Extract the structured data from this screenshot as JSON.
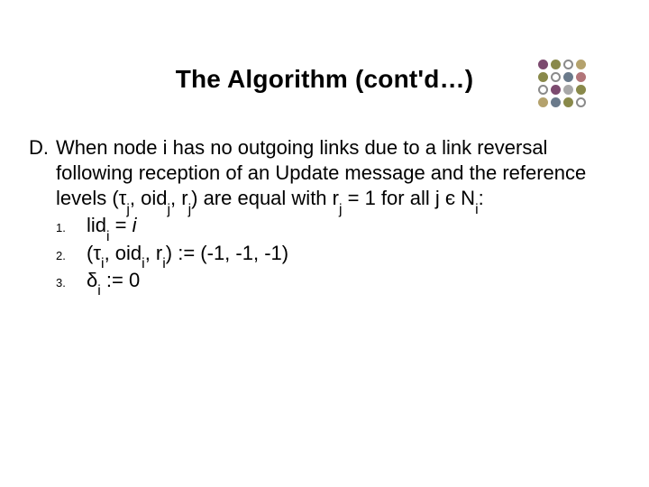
{
  "title": "The Algorithm (cont'd…)",
  "section": {
    "marker": "D.",
    "text_html": "When node i has no outgoing links due to a link reversal following reception of an Update message and the reference levels (τ<sub>j</sub>, oid<sub>j</sub>, r<sub>j</sub>) are equal with r<sub>j</sub> = 1 for all j є N<sub>i</sub>:"
  },
  "items": [
    {
      "num": "1.",
      "html": "lid<sub>i</sub> = <span class=\"ital\">i</span>"
    },
    {
      "num": "2.",
      "html": "(τ<sub>i</sub>, oid<sub>i</sub>, r<sub>i</sub>) := (-1, -1, -1)"
    },
    {
      "num": "3.",
      "html": "δ<sub>i</sub> := 0"
    }
  ],
  "deco_colors": [
    "d-plum",
    "d-olive",
    "d-outline",
    "d-tan",
    "d-olive",
    "d-outline",
    "d-slate",
    "d-rose",
    "d-outline",
    "d-plum",
    "d-grey",
    "d-olive",
    "d-tan",
    "d-slate",
    "d-olive",
    "d-outline"
  ]
}
